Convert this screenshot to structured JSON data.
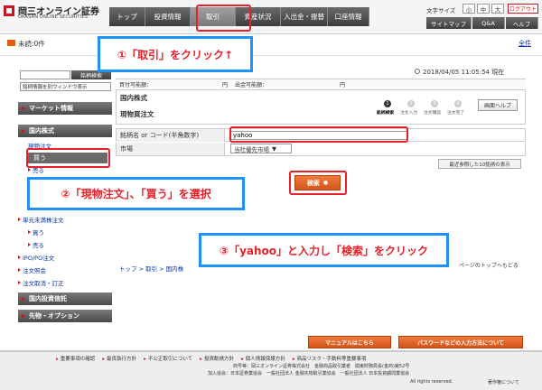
{
  "header": {
    "logo_text": "岡三オンライン証券",
    "logo_sub": "OKASAN ONLINE SECURITIES",
    "nav_tabs": [
      "トップ",
      "投資情報",
      "取引",
      "資産状況",
      "入出金・振替",
      "口座情報"
    ],
    "font_size_label": "文字サイズ",
    "font_sizes": [
      "小",
      "中",
      "大"
    ],
    "logout": "ログアウト",
    "util_links": [
      "サイトマップ",
      "Q&A",
      "ヘルプ"
    ]
  },
  "unread": {
    "text": "未読:0件",
    "all_link": "全件"
  },
  "sidebar": {
    "search_button": "銘柄検索",
    "new_window": "銘柄情報を別ウィンドウ表示",
    "market_info": "マーケット情報",
    "domestic_stock": "国内株式",
    "spot_order": "現物注文",
    "buy": "買う",
    "sell": "売る",
    "odd_lot": "単元未満株注文",
    "odd_buy": "買う",
    "odd_sell": "売る",
    "ipo": "IPO/PO注文",
    "order_inquiry": "注文照会",
    "order_cancel": "注文取消・訂正",
    "domestic_trust": "国内投資信託",
    "futures_options": "先物・オプション"
  },
  "main": {
    "datetime": "2018/04/05 11:05:54 現在",
    "buying_power_label": "買付可能額：",
    "withdraw_label": "出金可能額：",
    "yen": "円",
    "title1": "国内株式",
    "title2": "現物買注文",
    "steps": [
      "銘柄検索",
      "注文入力",
      "注文確認",
      "注文完了"
    ],
    "help_button": "画面ヘルプ",
    "code_label": "銘柄名 or コード(半角数字)",
    "code_value": "yahoo",
    "market_label": "市場",
    "market_value": "当社優先市場",
    "top10_button": "最近参照した10銘柄の表示",
    "search_button": "検索",
    "breadcrumb": "トップ > 取引 > 国内株",
    "page_top": "ページのトップへもどる"
  },
  "annotations": {
    "a1": "①「取引」をクリック↑",
    "a2": "②「現物注文」、「買う」を選択",
    "a3": "③「yahoo」と入力し「検索」をクリック"
  },
  "footer": {
    "manual_btn": "マニュアルはこちら",
    "password_btn": "パスワードなどの入力方法について",
    "links": [
      "重要事項の確認",
      "最良執行方針",
      "不公正取引について",
      "投資勧誘方針",
      "個人情報保護方針",
      "商品リスク・手数料等重要事項"
    ],
    "line1": "商号等：岡三オンライン証券株式会社　金融商品取引業者　関東財務局長(金商)第52号",
    "line2": "加入協会：日本証券業協会　一般社団法人 金融先物取引業協会　一般社団法人 日本投資顧問業協会",
    "copyright": "All rights reserved.",
    "terms": "著作権について"
  },
  "colors": {
    "accent_red": "#e8202a",
    "annotation_blue": "#1e90ff",
    "brand_red": "#c8161d",
    "button_orange": "#d2541a"
  }
}
